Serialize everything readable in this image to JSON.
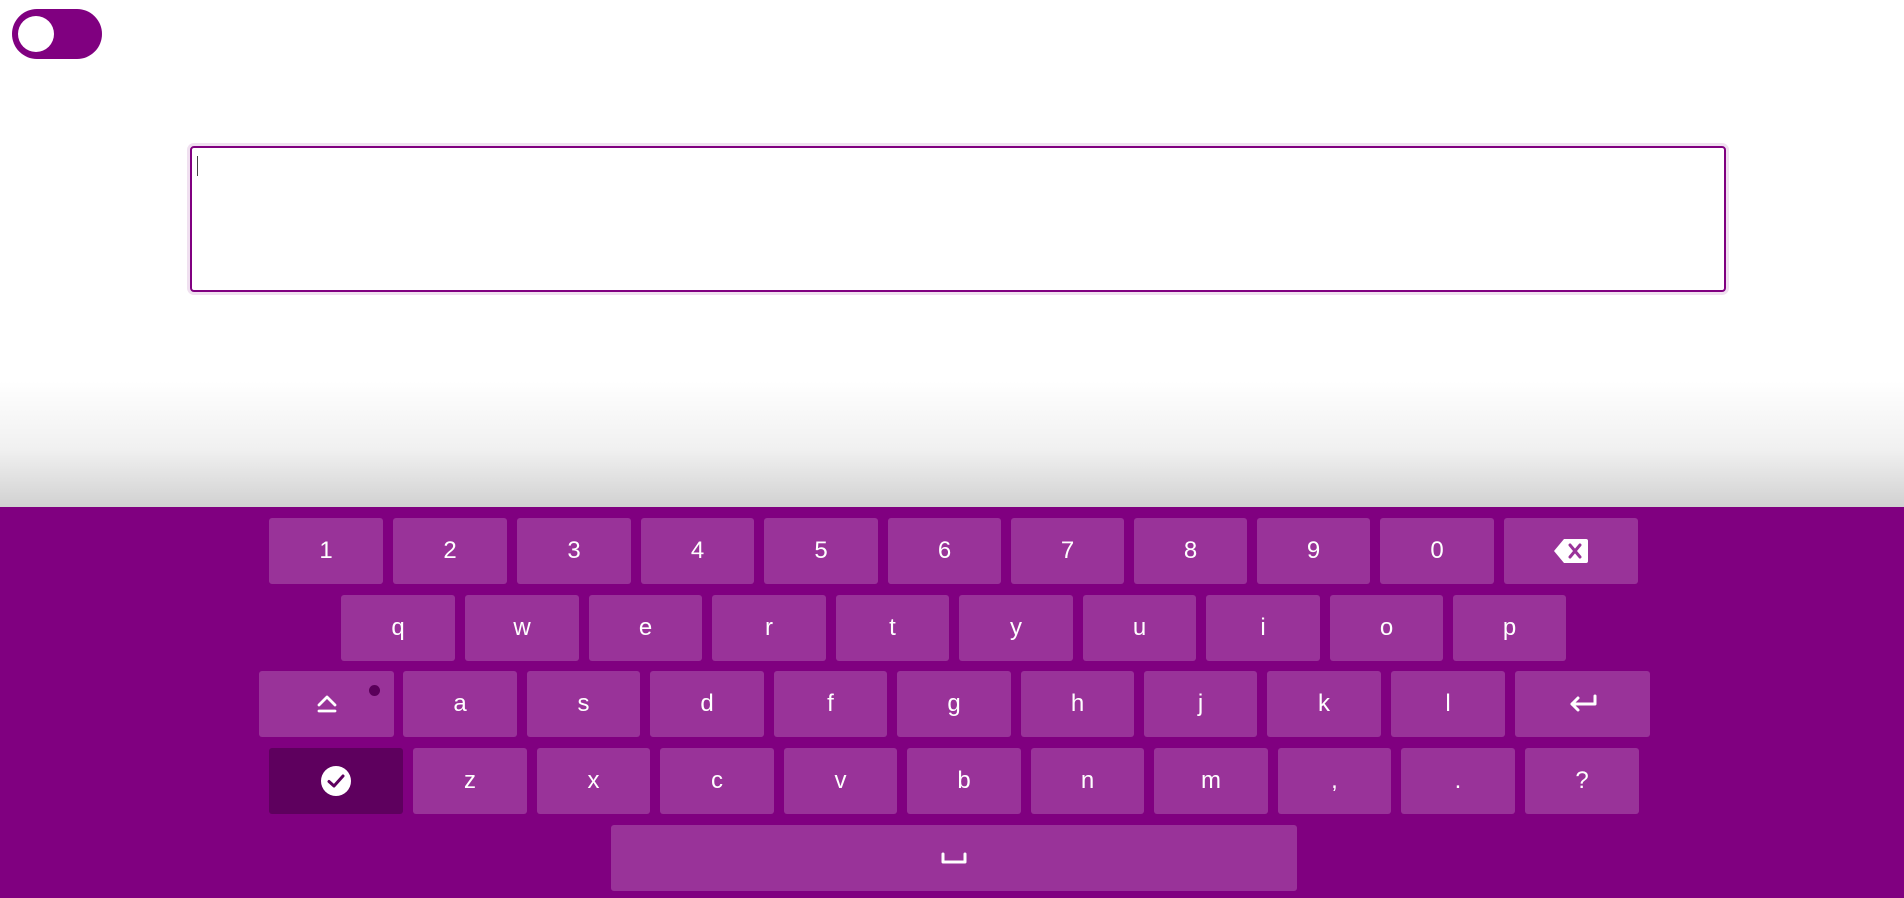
{
  "toggle": {
    "state": "off"
  },
  "text_input": {
    "value": ""
  },
  "keyboard": {
    "colors": {
      "background": "#800080",
      "key": "#993399",
      "key_dark": "#5e005e"
    },
    "row1": [
      "1",
      "2",
      "3",
      "4",
      "5",
      "6",
      "7",
      "8",
      "9",
      "0"
    ],
    "row2": [
      "q",
      "w",
      "e",
      "r",
      "t",
      "y",
      "u",
      "i",
      "o",
      "p"
    ],
    "row3": [
      "a",
      "s",
      "d",
      "f",
      "g",
      "h",
      "j",
      "k",
      "l"
    ],
    "row4": [
      "z",
      "x",
      "c",
      "v",
      "b",
      "n",
      "m",
      ",",
      ".",
      "?"
    ],
    "icons": {
      "backspace": "backspace-icon",
      "shift": "shift-icon",
      "enter": "enter-icon",
      "done": "check-circle-icon",
      "space": "space-bar-icon"
    }
  }
}
